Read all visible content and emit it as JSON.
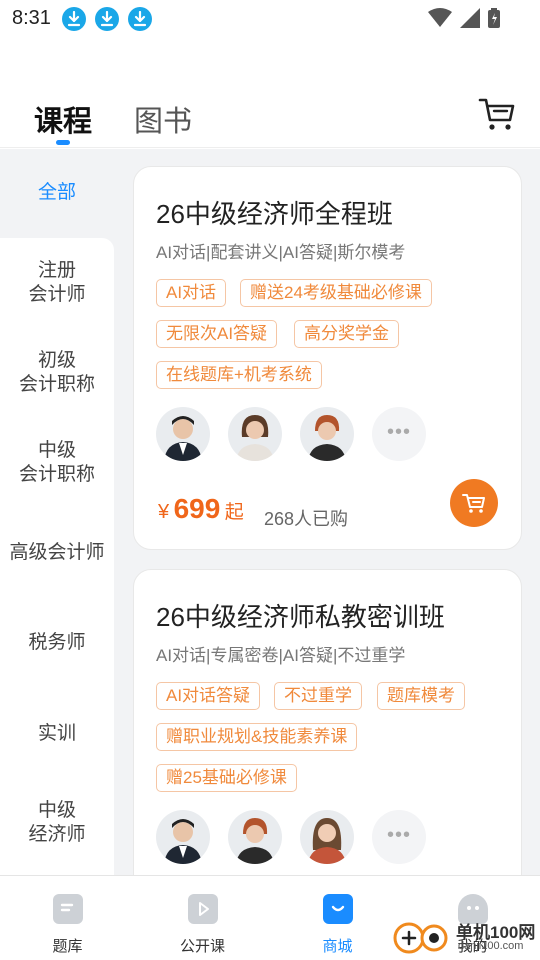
{
  "status_bar": {
    "time": "8:31"
  },
  "header": {
    "tabs": [
      {
        "label": "课程"
      },
      {
        "label": "图书"
      }
    ]
  },
  "sidebar": {
    "items": [
      {
        "line1": "全部",
        "line2": ""
      },
      {
        "line1": "注册",
        "line2": "会计师"
      },
      {
        "line1": "初级",
        "line2": "会计职称"
      },
      {
        "line1": "中级",
        "line2": "会计职称"
      },
      {
        "line1": "高级会计师",
        "line2": ""
      },
      {
        "line1": "税务师",
        "line2": ""
      },
      {
        "line1": "实训",
        "line2": ""
      },
      {
        "line1": "中级",
        "line2": "经济师"
      }
    ]
  },
  "courses": [
    {
      "title": "26中级经济师全程班",
      "subtitle": "AI对话|配套讲义|AI答疑|斯尔模考",
      "tags": [
        "AI对话",
        "赠送24考级基础必修课",
        "无限次AI答疑",
        "高分奖学金",
        "在线题库+机考系统"
      ],
      "price_symbol": "¥",
      "price": "699",
      "price_suffix": "起",
      "sold": "268人已购",
      "more": "•••"
    },
    {
      "title": "26中级经济师私教密训班",
      "subtitle": "AI对话|专属密卷|AI答疑|不过重学",
      "tags": [
        "AI对话答疑",
        "不过重学",
        "题库模考",
        "赠职业规划&技能素养课",
        "赠25基础必修课"
      ],
      "more": "•••"
    }
  ],
  "bottom_nav": {
    "items": [
      {
        "label": "题库"
      },
      {
        "label": "公开课"
      },
      {
        "label": "商城"
      },
      {
        "label": "我的"
      }
    ]
  },
  "watermark": {
    "text": "单机100网",
    "sub": "danji100.com"
  },
  "colors": {
    "accent": "#1a8cff",
    "orange": "#f08a3c",
    "price": "#f0661a"
  }
}
